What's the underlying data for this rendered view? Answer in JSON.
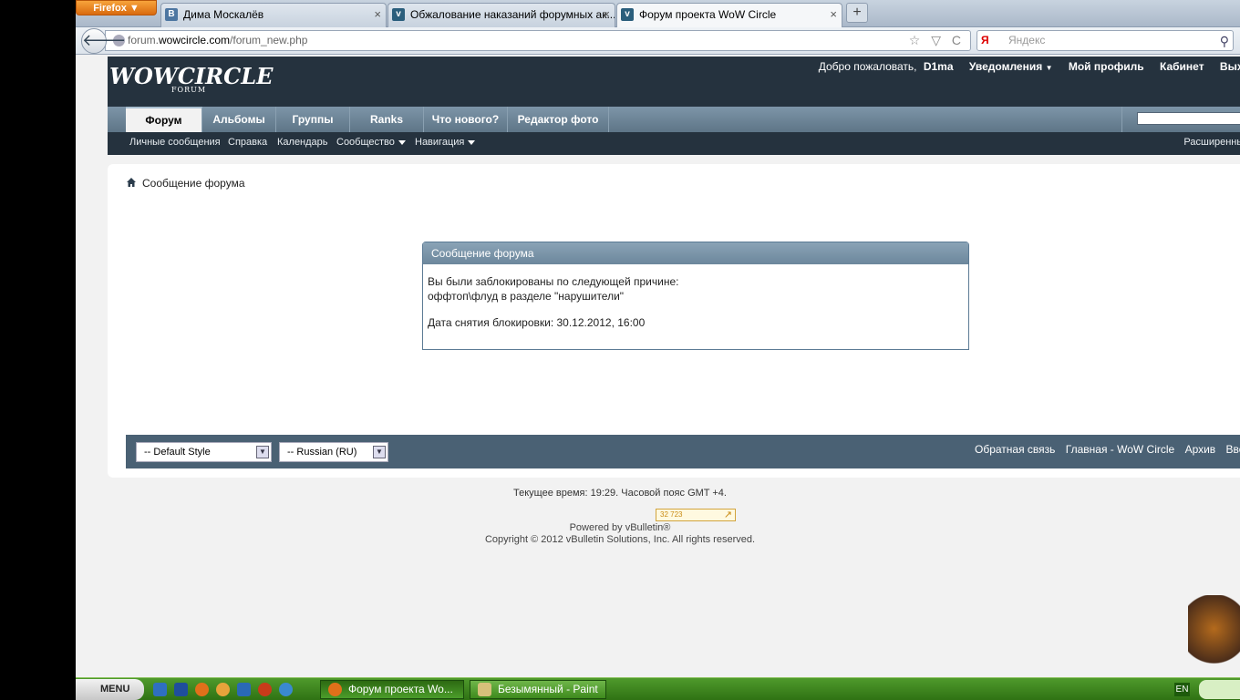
{
  "browser": {
    "firefox_label": "Firefox ▼",
    "tabs": [
      {
        "label": "Дима Москалёв",
        "icon": "vk-icon",
        "color": "#4d76a1"
      },
      {
        "label": "Обжалование наказаний форумных ак...",
        "icon": "vbulletin-icon",
        "color": "#2a5e7c"
      },
      {
        "label": "Форум проекта WoW Circle",
        "icon": "vbulletin-icon",
        "color": "#2a5e7c"
      }
    ],
    "tab_close": "×",
    "new_tab": "+",
    "url_prefix": "forum.",
    "url_host": "wowcircle.com",
    "url_path": "/forum_new.php",
    "url_icons": "☆ ▽ C",
    "search_engine": "Я",
    "search_placeholder": "Яндекс",
    "search_icon": "⚲"
  },
  "forum": {
    "logo": "WOWCIRCLE",
    "logo_sub": "FORUM",
    "welcome": "Добро пожаловать,",
    "username": "D1ma",
    "notifications": "Уведомления",
    "profile": "Мой профиль",
    "cabinet": "Кабинет",
    "logout": "Выход",
    "navtabs": [
      "Форум",
      "Альбомы",
      "Группы",
      "Ranks",
      "Что нового?",
      "Редактор фото"
    ],
    "subnav": [
      "Личные сообщения",
      "Справка",
      "Календарь",
      "Сообщество",
      "Навигация"
    ],
    "advanced_search": "Расширенный поиск",
    "breadcrumb": "Сообщение форума",
    "message": {
      "title": "Сообщение форума",
      "line1": "Вы были заблокированы по следующей причине:",
      "line2": "оффтоп\\флуд в разделе \"нарушители\"",
      "line3": "Дата снятия блокировки: 30.12.2012, 16:00"
    },
    "style_select": "-- Default Style",
    "lang_select": "-- Russian (RU)",
    "footer_links": [
      "Обратная связь",
      "Главная - WoW Circle",
      "Архив",
      "Вверх"
    ],
    "time_text": "Текущее время: ",
    "time_value": "19:29",
    "tz_text": ". Часовой пояс GMT +4.",
    "counter": "32 723",
    "powered": "Powered by vBulletin®",
    "copyright": "Copyright © 2012 vBulletin Solutions, Inc. All rights reserved."
  },
  "taskbar": {
    "menu": "MENU",
    "tasks": [
      {
        "label": "Форум проекта Wo...",
        "icon": "firefox-icon"
      },
      {
        "label": "Безымянный - Paint",
        "icon": "paint-icon"
      }
    ],
    "lang": "EN"
  },
  "colors": {
    "header_bg": "#25323e",
    "navtab_bg": "#6b8395",
    "footer_bg": "#4a6174",
    "taskbar": "#3e8a1d"
  }
}
